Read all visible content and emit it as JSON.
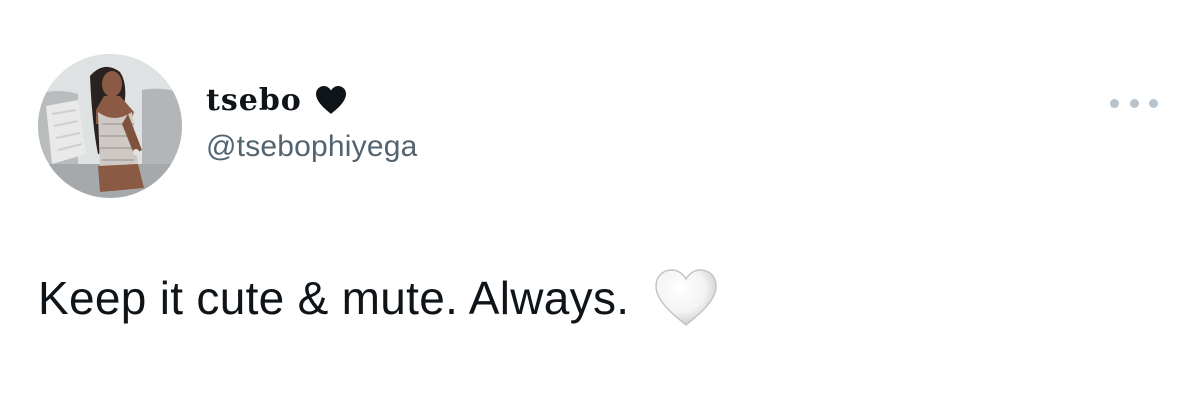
{
  "tweet": {
    "author": {
      "display_name": "tsebo",
      "name_emoji_icon": "black-heart-icon",
      "handle": "@tsebophiyega",
      "avatar_icon": "profile-photo"
    },
    "text": "Keep it cute & mute. Always.",
    "text_emoji_icon": "white-heart-icon",
    "more_icon": "more-options-icon"
  },
  "colors": {
    "text_primary": "#0f1419",
    "text_secondary": "#536471",
    "more_dots": "#b9c3cc",
    "background": "#ffffff"
  }
}
